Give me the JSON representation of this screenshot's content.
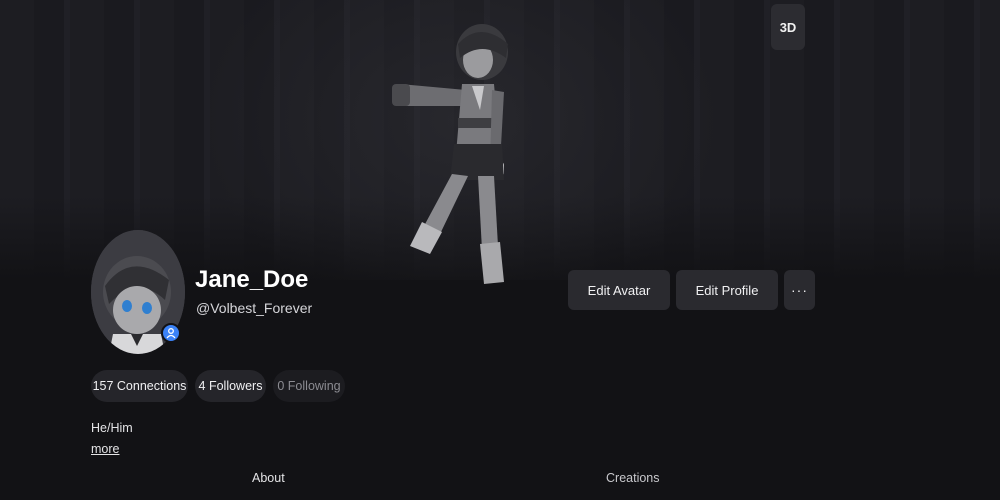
{
  "header": {
    "view_toggle_label": "3D"
  },
  "profile": {
    "display_name": "Jane_Doe",
    "username": "@Volbest_Forever",
    "actions": {
      "edit_avatar_label": "Edit Avatar",
      "edit_profile_label": "Edit Profile",
      "more_label": "···"
    },
    "stats": {
      "connections_label": "157 Connections",
      "followers_label": "4 Followers",
      "following_label": "0 Following"
    },
    "bio": "He/Him",
    "more_link_label": "more"
  },
  "tabs": [
    {
      "label": "About"
    },
    {
      "label": "Creations"
    }
  ],
  "icons": {
    "verified_badge": "user-badge-icon",
    "more": "ellipsis-icon"
  },
  "colors": {
    "background": "#121215",
    "button": "#2a2a2f",
    "badge": "#3b82f6"
  }
}
